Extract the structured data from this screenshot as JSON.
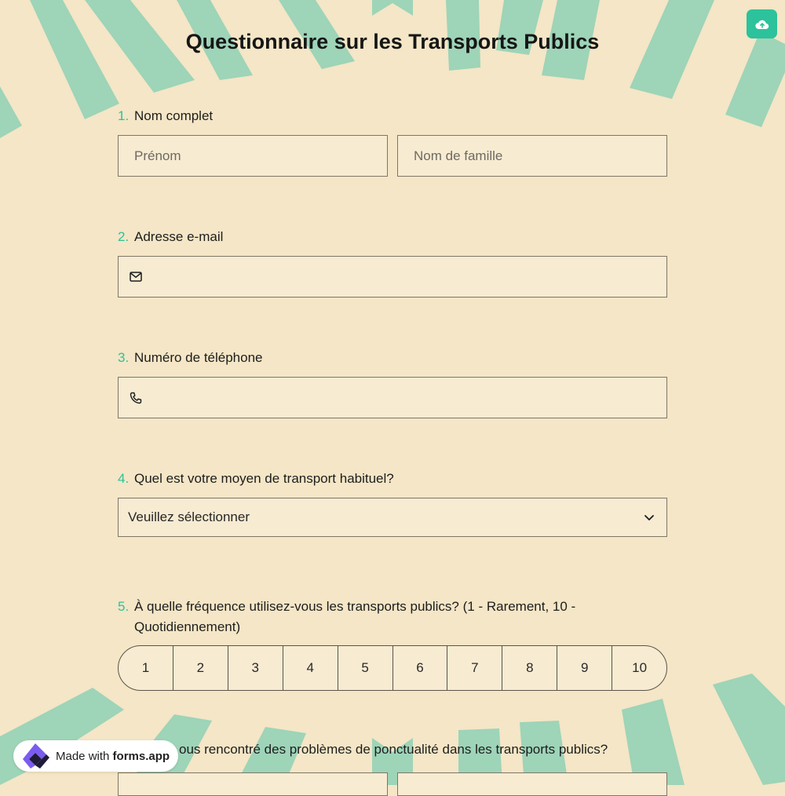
{
  "form": {
    "title": "Questionnaire sur les Transports Publics",
    "q1": {
      "number": "1.",
      "label": "Nom complet",
      "first_placeholder": "Prénom",
      "last_placeholder": "Nom de famille"
    },
    "q2": {
      "number": "2.",
      "label": "Adresse e-mail"
    },
    "q3": {
      "number": "3.",
      "label": "Numéro de téléphone"
    },
    "q4": {
      "number": "4.",
      "label": "Quel est votre moyen de transport habituel?",
      "selected": "Veuillez sélectionner"
    },
    "q5": {
      "number": "5.",
      "label": "À quelle fréquence utilisez-vous les transports publics? (1 - Rarement, 10 - Quotidiennement)",
      "scale": [
        "1",
        "2",
        "3",
        "4",
        "5",
        "6",
        "7",
        "8",
        "9",
        "10"
      ]
    },
    "q6": {
      "label_visible": "ous rencontré des problèmes de ponctualité dans les transports publics?"
    }
  },
  "badge": {
    "prefix": "Made with",
    "brand": "forms.app"
  },
  "icons": {
    "upload": "cloud-upload-icon",
    "email": "mail-icon",
    "phone": "phone-icon",
    "chevron": "chevron-down-icon",
    "brand": "forms-app-logo-icon"
  },
  "colors": {
    "accent": "#2cc29c",
    "background": "#f4e6c6",
    "stripe": "#9ed4b8",
    "field": "#f7ebd2"
  }
}
